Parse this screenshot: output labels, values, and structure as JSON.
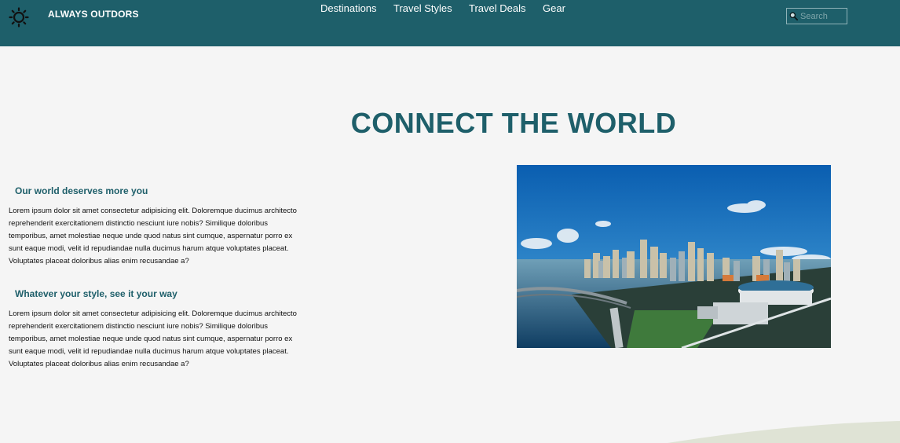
{
  "header": {
    "brand": "ALWAYS OUTDORS",
    "logo_icon": "sun-icon",
    "nav": [
      {
        "label": "Destinations"
      },
      {
        "label": "Travel Styles"
      },
      {
        "label": "Travel Deals"
      },
      {
        "label": "Gear"
      }
    ],
    "search": {
      "placeholder": "Search",
      "value": "",
      "icon": "search-icon"
    }
  },
  "main": {
    "title": "CONNECT THE WORLD",
    "sections": [
      {
        "heading": "Our world deserves more you",
        "body": "Lorem ipsum dolor sit amet consectetur adipisicing elit. Doloremque ducimus architecto reprehenderit exercitationem distinctio nesciunt iure nobis? Similique doloribus temporibus, amet molestiae neque unde quod natus sint cumque, aspernatur porro ex sunt eaque modi, velit id repudiandae nulla ducimus harum atque voluptates placeat. Voluptates placeat doloribus alias enim recusandae a?"
      },
      {
        "heading": "Whatever your style, see it your way",
        "body": "Lorem ipsum dolor sit amet consectetur adipisicing elit. Doloremque ducimus architecto reprehenderit exercitationem distinctio nesciunt iure nobis? Similique doloribus temporibus, amet molestiae neque unde quod natus sint cumque, aspernatur porro ex sunt eaque modi, velit id repudiandae nulla ducimus harum atque voluptates placeat. Voluptates placeat doloribus alias enim recusandae a?"
      }
    ],
    "hero_image": {
      "subject": "aerial-city-skyline-waterfront-photo"
    }
  },
  "colors": {
    "navbar": "#1e5f6a",
    "accent": "#1e5f6a",
    "page_background": "#f5f5f5"
  }
}
